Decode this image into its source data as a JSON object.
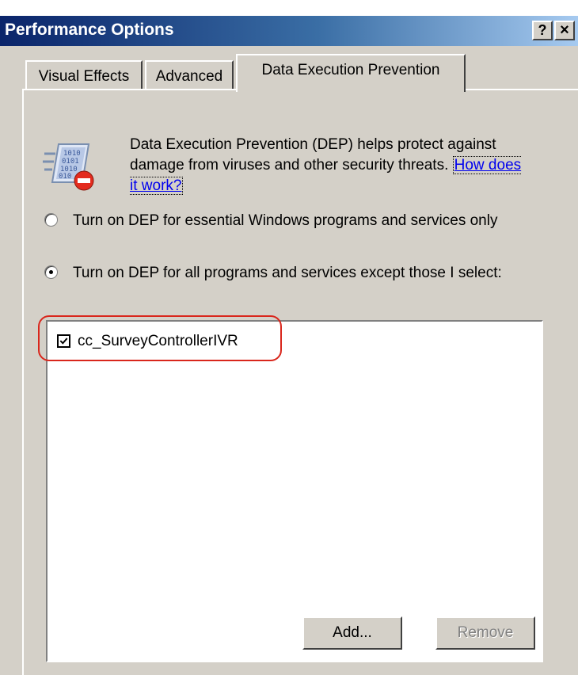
{
  "window": {
    "title": "Performance Options",
    "help_label": "?",
    "close_label": "×"
  },
  "tabs": [
    {
      "label": "Visual Effects"
    },
    {
      "label": "Advanced"
    },
    {
      "label": "Data Execution Prevention",
      "selected": true
    }
  ],
  "dep": {
    "description": "Data Execution Prevention (DEP) helps protect against damage from viruses and other security threats.",
    "link": "How does it work?",
    "option_essential": "Turn on DEP for essential Windows programs and services only",
    "option_all": "Turn on DEP for all programs and services except those I select:",
    "selected_option": "option_all"
  },
  "programs": [
    {
      "name": "cc_SurveyControllerIVR",
      "checked": true
    }
  ],
  "buttons": {
    "add": "Add...",
    "remove": "Remove"
  },
  "colors": {
    "titlebar_start": "#0a246a",
    "titlebar_end": "#a6caf0",
    "dialog_bg": "#d4d0c8",
    "annotation": "#d9261c"
  },
  "icons": [
    "dep-icon",
    "close-icon",
    "help-icon",
    "checkbox-checked-icon"
  ]
}
